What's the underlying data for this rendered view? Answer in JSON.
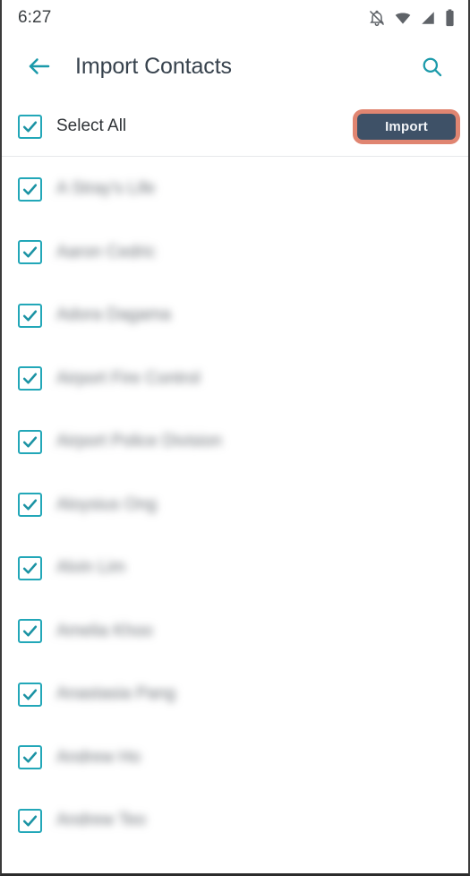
{
  "statusbar": {
    "time": "6:27",
    "icons": [
      {
        "name": "notifications-off-icon"
      },
      {
        "name": "wifi-icon"
      },
      {
        "name": "cellular-signal-icon"
      },
      {
        "name": "battery-icon"
      }
    ]
  },
  "appbar": {
    "back_icon": "back-arrow-icon",
    "title": "Import Contacts",
    "search_icon": "search-icon",
    "accent_color": "#22a7b8"
  },
  "selectall": {
    "label": "Select All",
    "checked": true,
    "import_label": "Import",
    "import_bg": "#3e5167",
    "import_highlight": "#e08571"
  },
  "contacts": [
    {
      "name": "A Stray's Life",
      "checked": true
    },
    {
      "name": "Aaron Cedric",
      "checked": true
    },
    {
      "name": "Adora Dagama",
      "checked": true
    },
    {
      "name": "Airport Fire Control",
      "checked": true
    },
    {
      "name": "Airport Police Division",
      "checked": true
    },
    {
      "name": "Aloysius Ong",
      "checked": true
    },
    {
      "name": "Alvin Lim",
      "checked": true
    },
    {
      "name": "Amelia Khoo",
      "checked": true
    },
    {
      "name": "Anastasia Pang",
      "checked": true
    },
    {
      "name": "Andrew Ho",
      "checked": true
    },
    {
      "name": "Andrew Teo",
      "checked": true
    }
  ]
}
